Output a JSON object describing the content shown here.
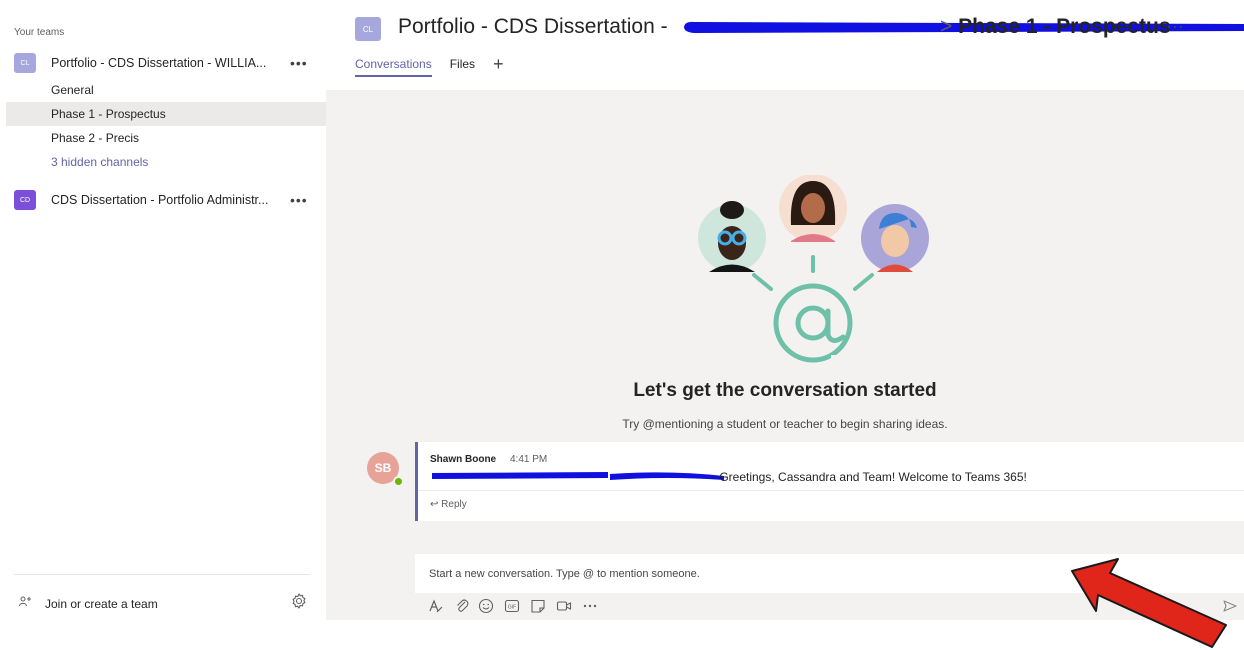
{
  "sidebar": {
    "heading": "Your teams",
    "teams": [
      {
        "avatar": "CL",
        "avatar_color": "#a6a7dc",
        "name": "Portfolio - CDS Dissertation - WILLIA...",
        "more": "•••",
        "channels": [
          {
            "label": "General"
          },
          {
            "label": "Phase 1 - Prospectus"
          },
          {
            "label": "Phase 2 - Precis"
          },
          {
            "label": "3 hidden channels"
          }
        ]
      },
      {
        "avatar": "CD",
        "avatar_color": "#7b4fd9",
        "name": "CDS Dissertation - Portfolio Administr...",
        "more": "•••"
      }
    ],
    "join_label": "Join or create a team"
  },
  "header": {
    "avatar": "CL",
    "title": "Portfolio - CDS Dissertation -",
    "separator": ">",
    "channel": "Phase 1 - Prospectus",
    "more": "···"
  },
  "tabs": [
    {
      "label": "Conversations"
    },
    {
      "label": "Files"
    }
  ],
  "tab_add": "+",
  "empty_state": {
    "title": "Let's get the conversation started",
    "subtitle": "Try @mentioning a student or teacher to begin sharing ideas."
  },
  "message": {
    "avatar": "SB",
    "author": "Shawn Boone",
    "time": "4:41 PM",
    "text": "- Greetings, Cassandra and Team!  Welcome to Teams 365!",
    "reply": "↩  Reply"
  },
  "compose": {
    "placeholder": "Start a new conversation. Type @ to mention someone."
  },
  "colors": {
    "accent": "#6264a7",
    "redaction": "#1010e0",
    "arrow": "#e0261b"
  }
}
